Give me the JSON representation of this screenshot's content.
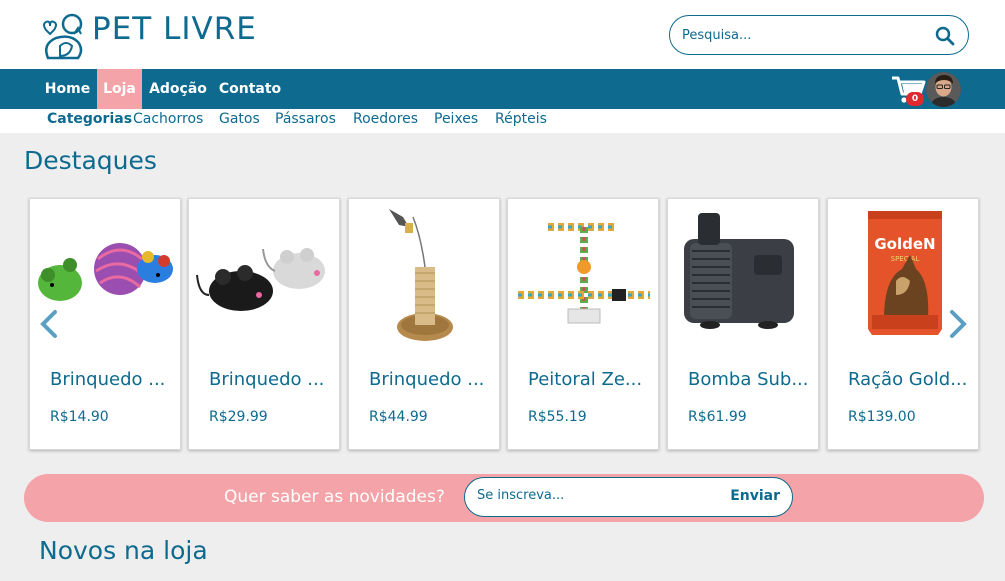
{
  "brand": {
    "name": "PET LIVRE"
  },
  "search": {
    "placeholder": "Pesquisa..."
  },
  "nav": {
    "items": [
      {
        "label": "Home",
        "active": false
      },
      {
        "label": "Loja",
        "active": true
      },
      {
        "label": "Adoção",
        "active": false
      },
      {
        "label": "Contato",
        "active": false
      }
    ],
    "cart_count": "0"
  },
  "categories": {
    "title": "Categorias",
    "items": [
      "Cachorros",
      "Gatos",
      "Pássaros",
      "Roedores",
      "Peixes",
      "Répteis"
    ]
  },
  "featured": {
    "title": "Destaques",
    "products": [
      {
        "name": "Brinquedo ...",
        "price": "R$14.90"
      },
      {
        "name": "Brinquedo ...",
        "price": "R$29.99"
      },
      {
        "name": "Brinquedo ...",
        "price": "R$44.99"
      },
      {
        "name": "Peitoral Ze...",
        "price": "R$55.19"
      },
      {
        "name": "Bomba Sub...",
        "price": "R$61.99"
      },
      {
        "name": "Ração Gold...",
        "price": "R$139.00"
      }
    ]
  },
  "newsletter": {
    "text": "Quer saber as novidades?",
    "placeholder": "Se inscreva...",
    "button": "Enviar"
  },
  "new_section": {
    "title": "Novos na loja"
  },
  "colors": {
    "primary": "#0e6a8f",
    "accent": "#f4a4a8",
    "badge": "#e0282e",
    "background": "#eeeeee"
  },
  "product_label": {
    "brand_golden": "GoldeN",
    "brand_golden_sub": "SPECIAL"
  }
}
